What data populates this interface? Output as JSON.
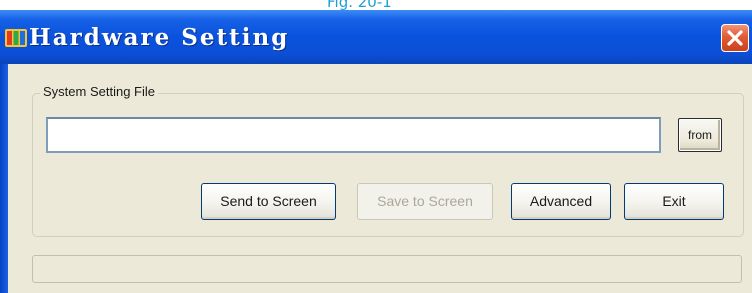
{
  "caption": "Fig. 20-1",
  "window": {
    "title": "Hardware Setting",
    "icon": "led-app-icon",
    "close_icon": "close-icon"
  },
  "system_setting": {
    "group_label": "System Setting File",
    "file_path_value": "",
    "from_label": "from"
  },
  "buttons": {
    "send_to_screen": "Send to Screen",
    "save_to_screen": "Save to Screen",
    "advanced": "Advanced",
    "exit": "Exit"
  },
  "status": {
    "text": ""
  },
  "colors": {
    "titlebar": "#0a52dd",
    "window_bg": "#ece9d8",
    "close_button": "#e25b35",
    "caption_text": "#1e9fd8",
    "disabled_text": "#aca899"
  }
}
